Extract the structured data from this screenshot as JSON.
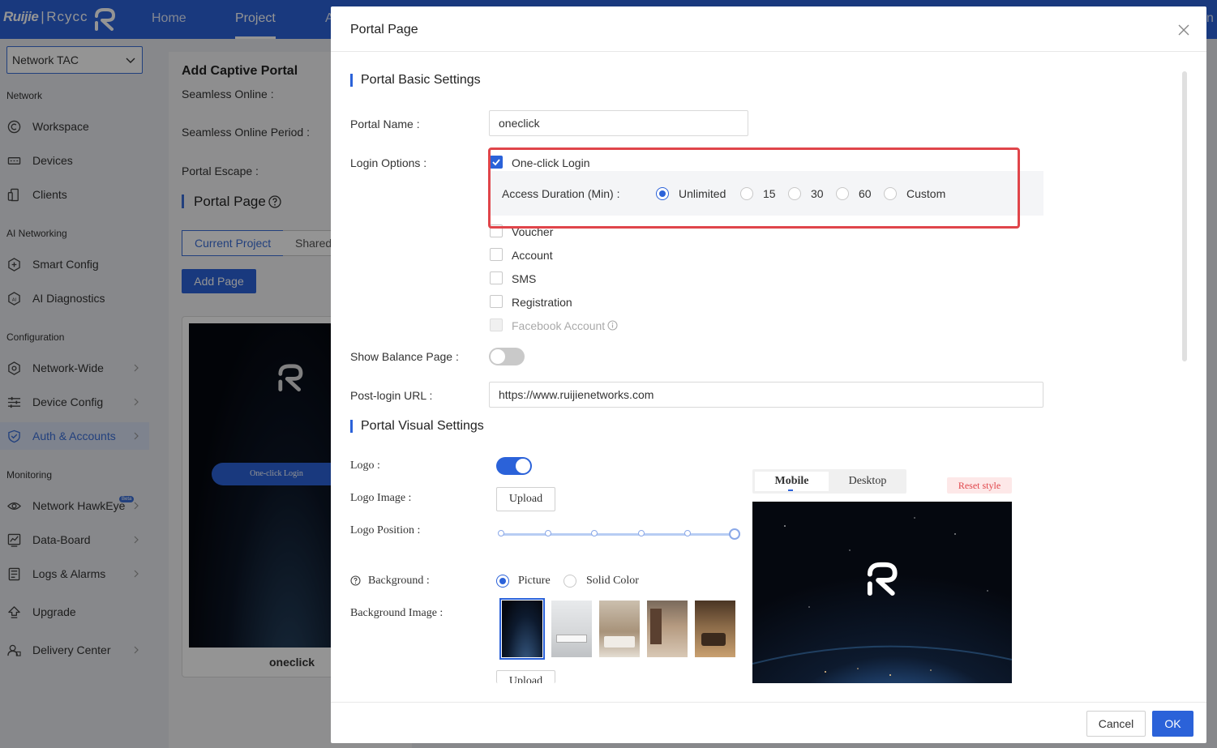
{
  "app": {
    "brand_left": "Ruijie",
    "brand_sep": "|",
    "brand_right": "Rcycc",
    "nav": [
      "Home",
      "Project",
      "A"
    ],
    "nav_active": "Project",
    "nav_right_fragment": "n"
  },
  "sidebar": {
    "network_select": "Network TAC",
    "groups": {
      "network": "Network",
      "ai_networking": "AI Networking",
      "configuration": "Configuration",
      "monitoring": "Monitoring"
    },
    "items": [
      {
        "label": "Workspace",
        "icon": "workspace-icon"
      },
      {
        "label": "Devices",
        "icon": "devices-icon"
      },
      {
        "label": "Clients",
        "icon": "clients-icon"
      },
      {
        "label": "Smart Config",
        "icon": "smart-config-icon"
      },
      {
        "label": "AI Diagnostics",
        "icon": "ai-diagnostics-icon"
      },
      {
        "label": "Network-Wide",
        "icon": "network-wide-icon"
      },
      {
        "label": "Device Config",
        "icon": "device-config-icon"
      },
      {
        "label": "Auth & Accounts",
        "icon": "shield-icon",
        "active": true
      },
      {
        "label": "Network HawkEye",
        "icon": "eye-icon",
        "badge": "Beta"
      },
      {
        "label": "Data-Board",
        "icon": "chart-icon"
      },
      {
        "label": "Logs & Alarms",
        "icon": "logs-icon"
      },
      {
        "label": "Upgrade",
        "icon": "upgrade-icon"
      },
      {
        "label": "Delivery Center",
        "icon": "delivery-icon"
      }
    ]
  },
  "background_page": {
    "title": "Add Captive Portal",
    "labels": [
      "Seamless Online :",
      "Seamless Online Period :",
      "Portal Escape :"
    ],
    "portal_page_heading": "Portal Page",
    "tabs": [
      "Current Project",
      "Shared"
    ],
    "add_page_button": "Add Page",
    "card_button": "One-click Login",
    "card_name": "oneclick"
  },
  "modal": {
    "title": "Portal Page",
    "basic_settings_heading": "Portal Basic Settings",
    "portal_name_label": "Portal Name :",
    "portal_name_value": "oneclick",
    "login_options_label": "Login Options :",
    "login_options": [
      {
        "label": "One-click Login",
        "checked": true
      },
      {
        "label": "Voucher",
        "checked": false
      },
      {
        "label": "Account",
        "checked": false
      },
      {
        "label": "SMS",
        "checked": false
      },
      {
        "label": "Registration",
        "checked": false
      },
      {
        "label": "Facebook Account",
        "checked": false,
        "disabled": true
      }
    ],
    "access_duration_label": "Access Duration (Min) :",
    "access_duration_options": [
      "Unlimited",
      "15",
      "30",
      "60",
      "Custom"
    ],
    "access_duration_selected": "Unlimited",
    "show_balance_label": "Show Balance Page :",
    "show_balance_on": false,
    "post_login_label": "Post-login URL :",
    "post_login_value": "https://www.ruijienetworks.com",
    "visual_settings_heading": "Portal Visual Settings",
    "logo_label": "Logo :",
    "logo_on": true,
    "logo_image_label": "Logo Image :",
    "upload_button": "Upload",
    "logo_position_label": "Logo Position :",
    "logo_position_step": 5,
    "logo_position_steps": 5,
    "background_label": "Background :",
    "background_options": [
      "Picture",
      "Solid Color"
    ],
    "background_selected": "Picture",
    "background_image_label": "Background Image :",
    "background_images_selected_index": 0,
    "upload_button_2": "Upload",
    "preview_tabs": [
      "Mobile",
      "Desktop"
    ],
    "preview_active": "Mobile",
    "reset_style": "Reset style",
    "cancel_button": "Cancel",
    "ok_button": "OK"
  },
  "colors": {
    "brand_blue": "#2b62d9",
    "highlight_red": "#e0454a"
  }
}
